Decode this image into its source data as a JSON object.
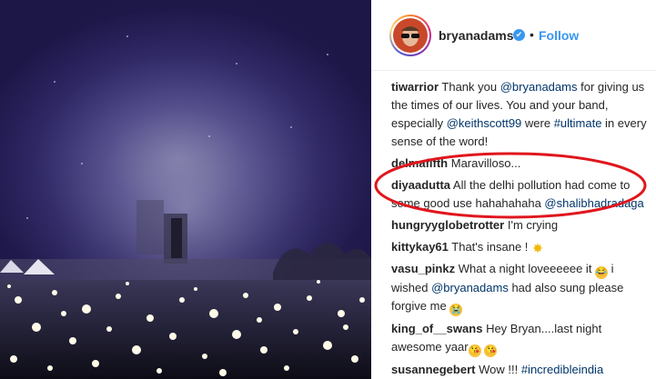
{
  "post": {
    "username": "bryanadams",
    "separator": "•",
    "follow_label": "Follow",
    "verified_icon": "✔"
  },
  "comments": [
    {
      "user": "tiwarrior",
      "parts": [
        {
          "t": "Thank you "
        },
        {
          "t": "@bryanadams",
          "link": true
        },
        {
          "t": " for giving us the times of our lives. You and your band, especially "
        },
        {
          "t": "@keithscott99",
          "link": true
        },
        {
          "t": " were "
        },
        {
          "t": "#ultimate",
          "link": true
        },
        {
          "t": " in every sense of the word!"
        }
      ]
    },
    {
      "user": "delmafifth",
      "parts": [
        {
          "t": "Maravilloso..."
        }
      ]
    },
    {
      "user": "diyaadutta",
      "parts": [
        {
          "t": "All the delhi pollution had come to some good use hahahahaha "
        },
        {
          "t": "@shalibhadradaga",
          "link": true
        }
      ]
    },
    {
      "user": "hungryyglobetrotter",
      "parts": [
        {
          "t": "I'm crying"
        }
      ]
    },
    {
      "user": "kittykay61",
      "parts": [
        {
          "t": "That's insane ! "
        },
        {
          "emoji": "burst",
          "g": "✸"
        }
      ]
    },
    {
      "user": "vasu_pinkz",
      "parts": [
        {
          "t": "What a night loveeeeee it "
        },
        {
          "emoji": "joy",
          "g": "😂"
        },
        {
          "t": " i wished "
        },
        {
          "t": "@bryanadams",
          "link": true
        },
        {
          "t": " had also sung please forgive me "
        },
        {
          "emoji": "cry",
          "g": "😭"
        }
      ]
    },
    {
      "user": "king_of__swans",
      "parts": [
        {
          "t": "Hey Bryan....last night awesome yaar"
        },
        {
          "emoji": "kiss",
          "g": "😘"
        },
        {
          "t": " "
        },
        {
          "emoji": "kiss",
          "g": "😘"
        }
      ]
    },
    {
      "user": "susannegebert",
      "parts": [
        {
          "t": "Wow !!! "
        },
        {
          "t": "#incredibleindia",
          "link": true
        }
      ]
    }
  ],
  "colors": {
    "accent": "#3897f0",
    "link": "#003569",
    "highlight": "#e0161d"
  }
}
